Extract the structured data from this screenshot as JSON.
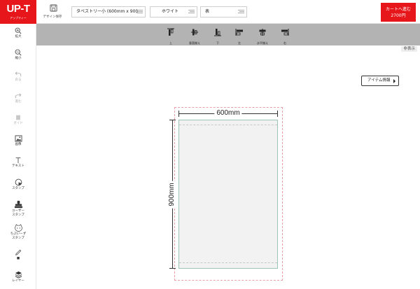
{
  "header": {
    "logo_text": "UP-T",
    "logo_subtext": "アップティー",
    "save_label": "デザイン保存",
    "product_select": "タペストリー小 (600mm x 900",
    "color_select": "ホワイト",
    "side_select": "表",
    "cart_label": "カートへ進む",
    "cart_price": "2700円"
  },
  "sidebar": {
    "items": [
      {
        "label": "拡大",
        "icon": "zoom-in-icon",
        "enabled": true
      },
      {
        "label": "縮小",
        "icon": "zoom-out-icon",
        "enabled": true
      },
      {
        "label": "戻る",
        "icon": "undo-icon",
        "enabled": false
      },
      {
        "label": "進む",
        "icon": "redo-icon",
        "enabled": false
      },
      {
        "label": "ガイド",
        "icon": "guide-icon",
        "enabled": false
      },
      {
        "label": "画像",
        "icon": "image-icon",
        "enabled": true
      },
      {
        "label": "テキスト",
        "icon": "text-icon",
        "enabled": true
      },
      {
        "label": "スタンプ",
        "icon": "stamp-icon",
        "enabled": true
      },
      {
        "label1": "ユーザー",
        "label2": "スタンプ",
        "icon": "user-stamp-icon",
        "enabled": true
      },
      {
        "label1": "ちぷいーず",
        "label2": "スタンプ",
        "icon": "character-stamp-icon",
        "enabled": true
      },
      {
        "label": "■",
        "icon": "pen-icon",
        "enabled": true
      },
      {
        "label": "レイヤー",
        "icon": "layers-icon",
        "enabled": true
      }
    ]
  },
  "align_toolbar": {
    "buttons": [
      {
        "label": "上",
        "icon": "align-top-icon"
      },
      {
        "label": "垂直揃え",
        "icon": "align-vertical-center-icon"
      },
      {
        "label": "下",
        "icon": "align-bottom-icon"
      },
      {
        "label": "左",
        "icon": "align-left-icon"
      },
      {
        "label": "水平揃え",
        "icon": "align-horizontal-center-icon"
      },
      {
        "label": "右",
        "icon": "align-right-icon"
      }
    ],
    "hide_label": "非表示"
  },
  "canvas": {
    "item_info_label": "アイテム情報",
    "width_label": "600mm",
    "height_label": "900mm"
  },
  "colors": {
    "brand_red": "#e6161b",
    "toolbar_gray": "#b3b3b3",
    "design_area": "#f2f2f2",
    "bleed_line": "#e8a0a8",
    "print_border": "#9cc4b4"
  }
}
